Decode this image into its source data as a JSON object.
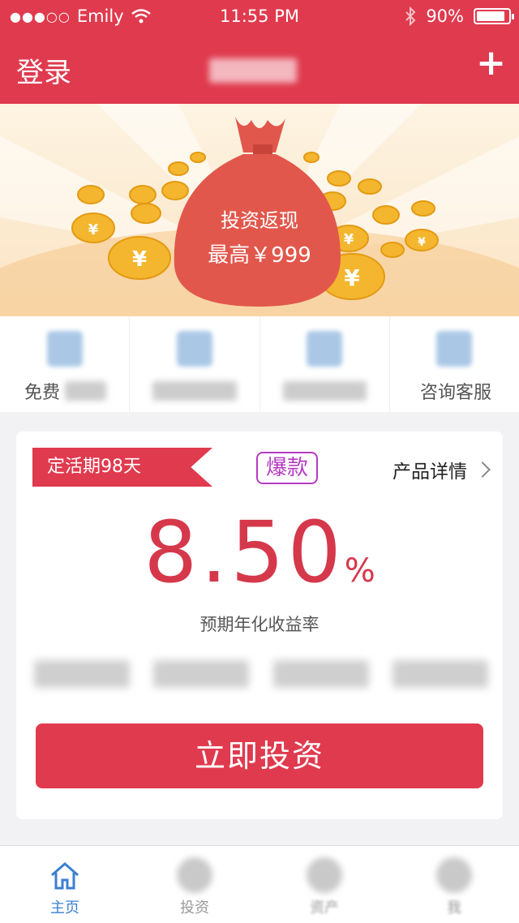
{
  "status_bar": {
    "signal_dots": "●●●○○",
    "carrier": "Emily",
    "time": "11:55 PM",
    "battery": "90%",
    "battery_level": 0.9
  },
  "nav": {
    "login": "登录",
    "add": "+"
  },
  "banner": {
    "line1": "投资返现",
    "line2": "最高￥999"
  },
  "quick_actions": [
    {
      "label": "免费",
      "icon": "user-icon"
    },
    {
      "label": "",
      "icon": "card-icon"
    },
    {
      "label": "",
      "icon": "chat-icon"
    },
    {
      "label": "咨询客服",
      "icon": "phone-icon"
    }
  ],
  "product": {
    "term_tag": "定活期98天",
    "hot_badge": "爆款",
    "detail_link": "产品详情",
    "rate_value": "8.50",
    "rate_unit": "%",
    "rate_label": "预期年化收益率",
    "invest_button": "立即投资"
  },
  "tabbar": [
    {
      "label": "主页",
      "icon": "home-icon",
      "active": true
    },
    {
      "label": "投资",
      "icon": "money-bag-icon",
      "active": false
    },
    {
      "label": "资产",
      "icon": "assets-icon",
      "active": false
    },
    {
      "label": "我",
      "icon": "profile-icon",
      "active": false
    }
  ],
  "colors": {
    "brand_red": "#e03a4e",
    "rate_red": "#d6384b",
    "hot_purple": "#b53ac2",
    "active_tab_blue": "#3b7fd0"
  }
}
